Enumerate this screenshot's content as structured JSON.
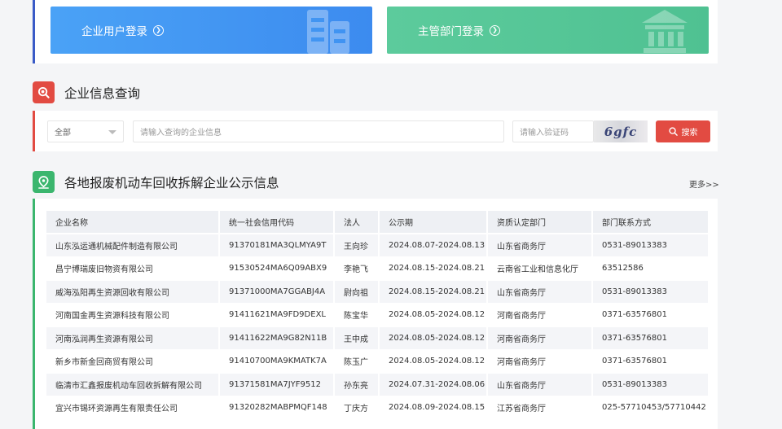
{
  "login": {
    "enterprise_label": "企业用户登录",
    "authority_label": "主管部门登录"
  },
  "query": {
    "title": "企业信息查询",
    "select_value": "全部",
    "main_placeholder": "请输入查询的企业信息",
    "captcha_placeholder": "请输入验证码",
    "captcha_text": "6gfc",
    "search_label": "搜索"
  },
  "notice": {
    "title": "各地报废机动车回收拆解企业公示信息",
    "more_label": "更多>>",
    "columns": [
      "企业名称",
      "统一社会信用代码",
      "法人",
      "公示期",
      "资质认定部门",
      "部门联系方式"
    ],
    "rows": [
      [
        "山东泓运通机械配件制造有限公司",
        "91370181MA3QLMYA9T",
        "王向珍",
        "2024.08.07-2024.08.13",
        "山东省商务厅",
        "0531-89013383"
      ],
      [
        "昌宁博瑞废旧物资有限公司",
        "91530524MA6Q09ABX9",
        "李艳飞",
        "2024.08.15-2024.08.21",
        "云南省工业和信息化厅",
        "63512586"
      ],
      [
        "威海泓阳再生资源回收有限公司",
        "91371000MA7GGABJ4A",
        "尉向祖",
        "2024.08.15-2024.08.21",
        "山东省商务厅",
        "0531-89013383"
      ],
      [
        "河南国金再生资源科技有限公司",
        "91411621MA9FD9DEXL",
        "陈宝华",
        "2024.08.05-2024.08.12",
        "河南省商务厅",
        "0371-63576801"
      ],
      [
        "河南泓润再生资源有限公司",
        "91411622MA9G82N11B",
        "王中成",
        "2024.08.05-2024.08.12",
        "河南省商务厅",
        "0371-63576801"
      ],
      [
        "新乡市新金回商贸有限公司",
        "91410700MA9KMATK7A",
        "陈玉广",
        "2024.08.05-2024.08.12",
        "河南省商务厅",
        "0371-63576801"
      ],
      [
        "临清市汇鑫报废机动车回收拆解有限公司",
        "91371581MA7JYF9512",
        "孙东亮",
        "2024.07.31-2024.08.06",
        "山东省商务厅",
        "0531-89013383"
      ],
      [
        "宜兴市锡环资源再生有限责任公司",
        "91320282MABPMQF148",
        "丁庆方",
        "2024.08.09-2024.08.15",
        "江苏省商务厅",
        "025-57710453/57710442"
      ]
    ]
  },
  "colors": {
    "accent_blue": "#3a5bc7",
    "accent_red": "#e24b42",
    "accent_green": "#3bb66e"
  }
}
